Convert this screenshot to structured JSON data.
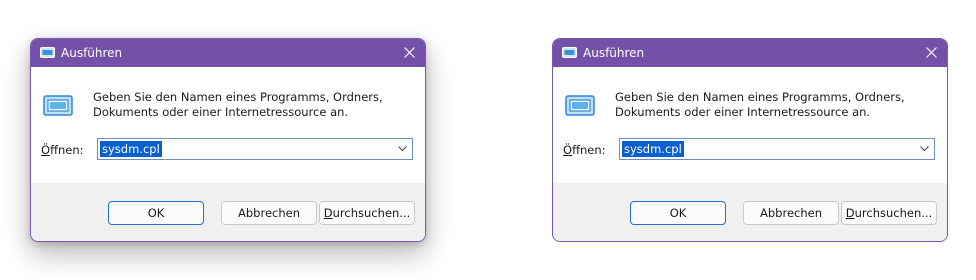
{
  "colors": {
    "titlebar": "#7451a8",
    "border": "#7b57ad",
    "selection": "#0a5fcf",
    "ok_border": "#1e6fd8"
  },
  "dialogs": [
    {
      "title": "Ausführen",
      "icon": "run-dialog-icon",
      "close_icon": "close-icon",
      "description": "Geben Sie den Namen eines Programms, Ordners, Dokuments oder einer Internetressource an.",
      "open_label_prefix": "Ö",
      "open_label_suffix": "ffnen:",
      "input_value": "sysdm.cpl",
      "dropdown_icon": "chevron-down-icon",
      "ok_label": "OK",
      "cancel_label": "Abbrechen",
      "browse_label_prefix": "D",
      "browse_label_suffix": "urchsuchen..."
    },
    {
      "title": "Ausführen",
      "icon": "run-dialog-icon",
      "close_icon": "close-icon",
      "description": "Geben Sie den Namen eines Programms, Ordners, Dokuments oder einer Internetressource an.",
      "open_label_prefix": "Ö",
      "open_label_suffix": "ffnen:",
      "input_value": "sysdm.cpl",
      "dropdown_icon": "chevron-down-icon",
      "ok_label": "OK",
      "cancel_label": "Abbrechen",
      "browse_label_prefix": "D",
      "browse_label_suffix": "urchsuchen..."
    }
  ]
}
